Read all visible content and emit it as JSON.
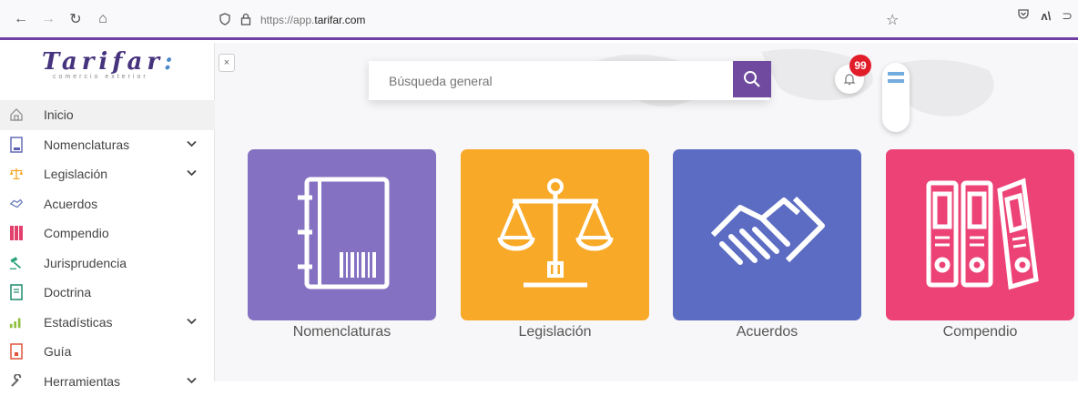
{
  "browser": {
    "url_prefix": "https://app.",
    "url_domain": "tarifar.com"
  },
  "logo": {
    "name": "Tarifar",
    "mark": ":",
    "tagline": "comercio exterior"
  },
  "sidebar": {
    "items": [
      {
        "label": "Inicio",
        "icon": "home-icon",
        "expandable": false,
        "active": true
      },
      {
        "label": "Nomenclaturas",
        "icon": "book-icon",
        "expandable": true
      },
      {
        "label": "Legislación",
        "icon": "scale-icon",
        "expandable": true
      },
      {
        "label": "Acuerdos",
        "icon": "handshake-icon",
        "expandable": false
      },
      {
        "label": "Compendio",
        "icon": "binders-icon",
        "expandable": false
      },
      {
        "label": "Jurisprudencia",
        "icon": "gavel-icon",
        "expandable": false
      },
      {
        "label": "Doctrina",
        "icon": "document-icon",
        "expandable": false
      },
      {
        "label": "Estadísticas",
        "icon": "chart-icon",
        "expandable": true
      },
      {
        "label": "Guía",
        "icon": "guide-icon",
        "expandable": false
      },
      {
        "label": "Herramientas",
        "icon": "wrench-icon",
        "expandable": true
      }
    ]
  },
  "search": {
    "placeholder": "Búsqueda general"
  },
  "notifications": {
    "count": "99"
  },
  "cards": [
    {
      "label": "Nomenclaturas",
      "color": "#8571c2",
      "icon": "book-barcode-icon"
    },
    {
      "label": "Legislación",
      "color": "#f8a928",
      "icon": "scale-icon"
    },
    {
      "label": "Acuerdos",
      "color": "#5b6cc2",
      "icon": "handshake-icon"
    },
    {
      "label": "Compendio",
      "color": "#ec4276",
      "icon": "binders-icon"
    }
  ]
}
